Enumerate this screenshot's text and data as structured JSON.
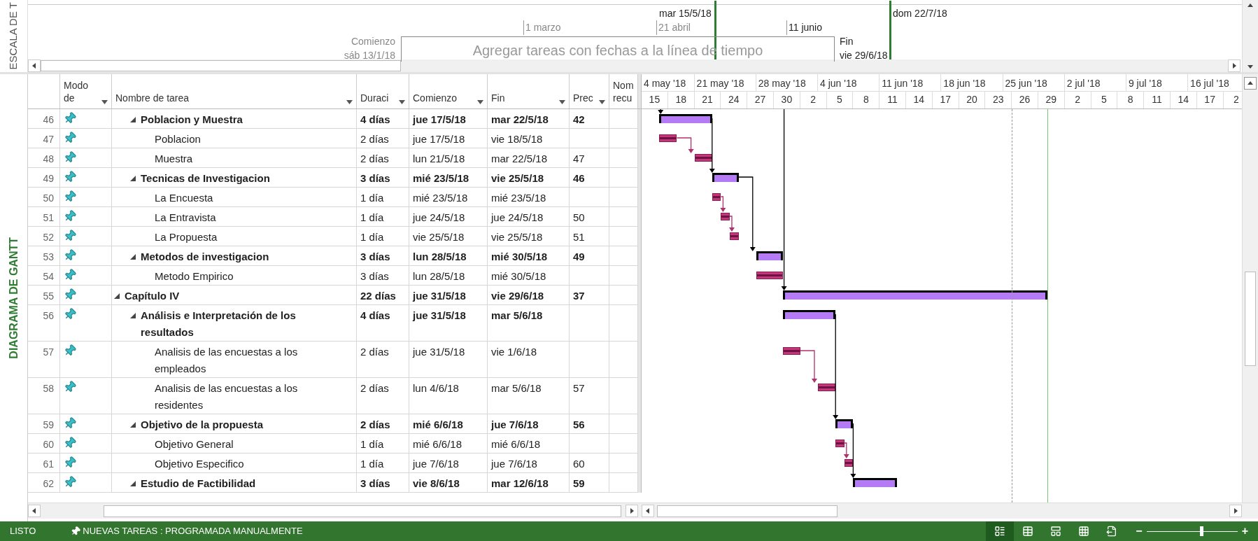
{
  "timeline": {
    "side_label": "ESCALA DE T",
    "today": "mar 15/5/18",
    "ticks": [
      {
        "label": "1 marzo",
        "strong": false
      },
      {
        "label": "21 abril",
        "strong": false
      },
      {
        "label": "11 junio",
        "strong": true
      }
    ],
    "start_label": "Comienzo",
    "start_date": "sáb 13/1/18",
    "finish_label": "Fin",
    "finish_date": "vie 29/6/18",
    "end_date": "dom 22/7/18",
    "hint": "Agregar tareas con fechas a la línea de tiempo"
  },
  "view_label": "DIAGRAMA DE GANTT",
  "columns": [
    {
      "label": "Modo de",
      "menu": true
    },
    {
      "label": "Nombre de tarea",
      "menu": true
    },
    {
      "label": "Duraci",
      "menu": true
    },
    {
      "label": "Comienzo",
      "menu": true
    },
    {
      "label": "Fin",
      "menu": true
    },
    {
      "label": "Prec",
      "menu": true
    },
    {
      "label": "Nom recu",
      "menu": false
    }
  ],
  "weeks": [
    "4 may '18",
    "21 may '18",
    "28 may '18",
    "4 jun '18",
    "11 jun '18",
    "18 jun '18",
    "25 jun '18",
    "2 jul '18",
    "9 jul '18",
    "16 jul '18"
  ],
  "days": [
    "15",
    "18",
    "21",
    "24",
    "27",
    "30",
    "2",
    "5",
    "8",
    "11",
    "14",
    "17",
    "20",
    "23",
    "26",
    "29",
    "2",
    "5",
    "8",
    "11",
    "14",
    "17",
    "2"
  ],
  "tasks": [
    {
      "children": [
        {
          "id": "46",
          "kind": "summary",
          "expanded": true,
          "name": "Poblacion y Muestra",
          "duration": "4 días",
          "start": "jue 17/5/18",
          "finish": "mar 22/5/18",
          "pred": "42",
          "children": [
            {
              "id": "47",
              "kind": "task",
              "name": "Poblacion",
              "duration": "2 días",
              "start": "jue 17/5/18",
              "finish": "vie 18/5/18"
            },
            {
              "id": "48",
              "kind": "task",
              "name": "Muestra",
              "duration": "2 días",
              "start": "lun 21/5/18",
              "finish": "mar 22/5/18",
              "pred": "47"
            }
          ]
        },
        {
          "id": "49",
          "kind": "summary",
          "expanded": true,
          "name": "Tecnicas de Investigacion",
          "duration": "3 días",
          "start": "mié 23/5/18",
          "finish": "vie 25/5/18",
          "pred": "46",
          "children": [
            {
              "id": "50",
              "kind": "task",
              "name": "La Encuesta",
              "duration": "1 día",
              "start": "mié 23/5/18",
              "finish": "mié 23/5/18"
            },
            {
              "id": "51",
              "kind": "task",
              "name": "La Entravista",
              "duration": "1 día",
              "start": "jue 24/5/18",
              "finish": "jue 24/5/18",
              "pred": "50"
            },
            {
              "id": "52",
              "kind": "task",
              "name": "La Propuesta",
              "duration": "1 día",
              "start": "vie 25/5/18",
              "finish": "vie 25/5/18",
              "pred": "51"
            }
          ]
        },
        {
          "id": "53",
          "kind": "summary",
          "expanded": true,
          "name": "Metodos de investigacion",
          "duration": "3 días",
          "start": "lun 28/5/18",
          "finish": "mié 30/5/18",
          "pred": "49",
          "children": [
            {
              "id": "54",
              "kind": "task",
              "name": "Metodo Empirico",
              "duration": "3 días",
              "start": "lun 28/5/18",
              "finish": "mié 30/5/18"
            }
          ]
        }
      ]
    },
    {
      "id": "55",
      "kind": "summary",
      "expanded": true,
      "name": "Capítulo IV",
      "duration": "22 días",
      "start": "jue 31/5/18",
      "finish": "vie 29/6/18",
      "pred": "37",
      "children": [
        {
          "id": "56",
          "kind": "summary",
          "expanded": true,
          "name": "Análisis e Interpretación de los resultados",
          "duration": "4 días",
          "start": "jue 31/5/18",
          "finish": "mar 5/6/18",
          "children": [
            {
              "id": "57",
              "kind": "task",
              "name": "Analisis de las encuestas a los empleados",
              "duration": "2 días",
              "start": "jue 31/5/18",
              "finish": "vie 1/6/18"
            },
            {
              "id": "58",
              "kind": "task",
              "name": "Analisis de las encuestas a los residentes",
              "duration": "2 días",
              "start": "lun 4/6/18",
              "finish": "mar 5/6/18",
              "pred": "57"
            }
          ]
        },
        {
          "id": "59",
          "kind": "summary",
          "expanded": true,
          "name": "Objetivo de la propuesta",
          "duration": "2 días",
          "start": "mié 6/6/18",
          "finish": "jue 7/6/18",
          "pred": "56",
          "children": [
            {
              "id": "60",
              "kind": "task",
              "name": "Objetivo General",
              "duration": "1 día",
              "start": "mié 6/6/18",
              "finish": "mié 6/6/18"
            },
            {
              "id": "61",
              "kind": "task",
              "name": "Objetivo Especifico",
              "duration": "1 día",
              "start": "jue 7/6/18",
              "finish": "jue 7/6/18",
              "pred": "60"
            }
          ]
        },
        {
          "id": "62",
          "kind": "summary",
          "expanded": true,
          "name": "Estudio de Factibilidad",
          "duration": "3 días",
          "start": "vie 8/6/18",
          "finish": "mar 12/6/18",
          "pred": "59"
        }
      ]
    }
  ],
  "status_bar": {
    "mode": "LISTO",
    "new_tasks": "NUEVAS TAREAS : PROGRAMADA MANUALMENTE",
    "views": [
      {
        "kind": "gantt",
        "selected": true
      },
      {
        "kind": "usage",
        "selected": false
      },
      {
        "kind": "team",
        "selected": false
      },
      {
        "kind": "sheet",
        "selected": false
      },
      {
        "kind": "report",
        "selected": false
      }
    ],
    "zoom": {
      "minus": "−",
      "plus": "+",
      "level": 0.6
    }
  }
}
